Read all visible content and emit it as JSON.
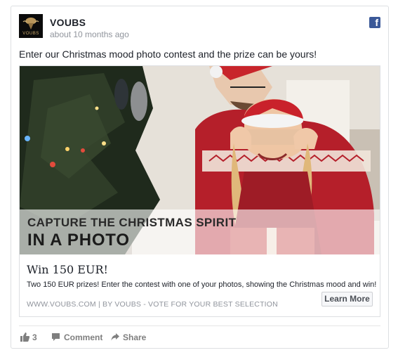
{
  "post": {
    "page_name": "VOUBS",
    "timestamp": "about 10 months ago",
    "avatar_logo_text": "VOUBS",
    "caption": "Enter our Christmas mood photo contest and the prize can be yours!"
  },
  "link_preview": {
    "image_text_line1": "CAPTURE THE CHRISTMAS SPIRIT",
    "image_text_line2": "IN A PHOTO",
    "title": "Win 150 EUR!",
    "description": "Two 150 EUR prizes! Enter the contest with one of your photos, showing the Christmas mood and win!",
    "domain_line": "WWW.VOUBS.COM | BY VOUBS - VOTE FOR YOUR BEST SELECTION",
    "cta_label": "Learn More"
  },
  "actions": {
    "like_count": "3",
    "comment_label": "Comment",
    "share_label": "Share"
  },
  "colors": {
    "facebook_blue": "#3b5998",
    "text": "#1d2129",
    "muted": "#90949c"
  },
  "icons": [
    "facebook-icon",
    "like-icon",
    "comment-icon",
    "share-icon"
  ]
}
